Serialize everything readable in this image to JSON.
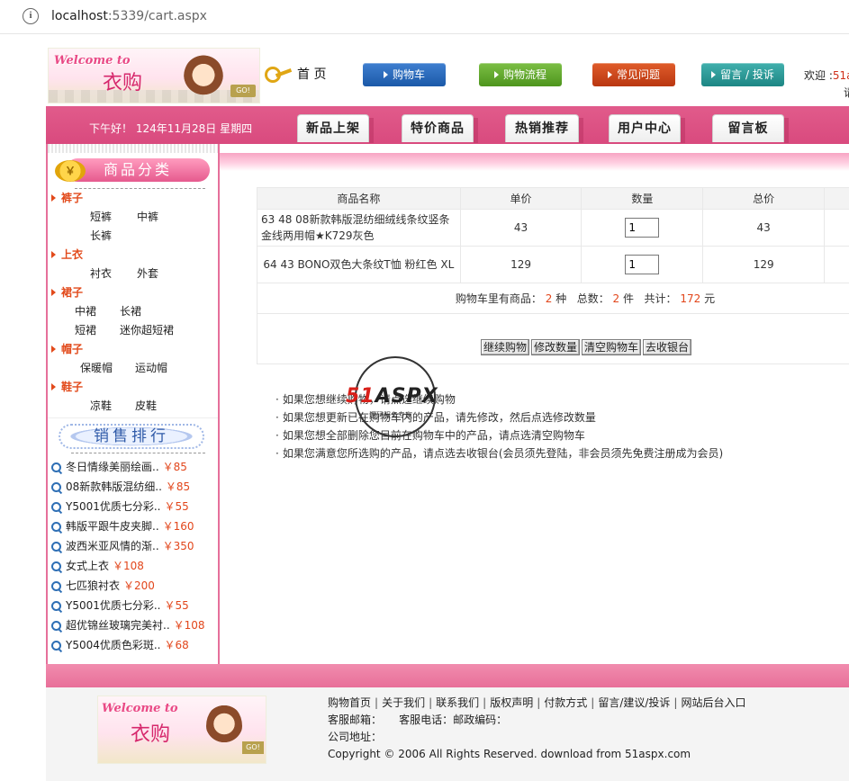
{
  "browser": {
    "host": "localhost",
    "port": ":5339",
    "path": "/cart.aspx"
  },
  "header": {
    "logo_welcome": "Welcome to",
    "logo_name": "衣购",
    "logo_go": "GO!",
    "home_label": "首 页",
    "nav": [
      {
        "label": "购物车",
        "color": "#1b59a8"
      },
      {
        "label": "购物流程",
        "color": "#4e951d"
      },
      {
        "label": "常见问题",
        "color": "#b93711"
      },
      {
        "label": "留言 / 投诉",
        "color": "#1d8684"
      }
    ],
    "welcome_prefix": "欢迎 :",
    "welcome_user": "51a",
    "welcome_line2": "请"
  },
  "menubar": {
    "greeting": "下午好！ 124年11月28日 星期四",
    "tabs": [
      "新品上架",
      "特价商品",
      "热销推荐",
      "用户中心",
      "留言板"
    ]
  },
  "sidebar": {
    "category_title": "商品分类",
    "coin": "￥",
    "categories": [
      {
        "title": "裤子",
        "items": [
          "短裤",
          "中裤",
          "长裤"
        ]
      },
      {
        "title": "上衣",
        "items": [
          "衬衣",
          "外套"
        ]
      },
      {
        "title": "裙子",
        "items": [
          "中裙",
          "长裙",
          "短裙",
          "迷你超短裙"
        ]
      },
      {
        "title": "帽子",
        "items": [
          "保暖帽",
          "运动帽"
        ]
      },
      {
        "title": "鞋子",
        "items": [
          "凉鞋",
          "皮鞋"
        ]
      }
    ],
    "ranking_title": "销售排行",
    "ranking": [
      {
        "name": "冬日情缘美丽绘画..",
        "price": "￥85"
      },
      {
        "name": "08新款韩版混纺细..",
        "price": "￥85"
      },
      {
        "name": "Y5001优质七分彩..",
        "price": "￥55"
      },
      {
        "name": "韩版平跟牛皮夹脚..",
        "price": "￥160"
      },
      {
        "name": "波西米亚风情的渐..",
        "price": "￥350"
      },
      {
        "name": "女式上衣",
        "price": "￥108"
      },
      {
        "name": "七匹狼衬衣",
        "price": "￥200"
      },
      {
        "name": "Y5001优质七分彩..",
        "price": "￥55"
      },
      {
        "name": "超优锦丝玻璃完美衬..",
        "price": "￥108"
      },
      {
        "name": "Y5004优质色彩斑..",
        "price": "￥68"
      }
    ]
  },
  "cart": {
    "headers": [
      "商品名称",
      "单价",
      "数量",
      "总价"
    ],
    "rows": [
      {
        "name": "63 48 08新款韩版混纺细绒线条纹竖条金线两用帽★K729灰色",
        "price": "43",
        "qty": "1",
        "total": "43"
      },
      {
        "name": "64 43 BONO双色大条纹T恤 粉红色 XL",
        "price": "129",
        "qty": "1",
        "total": "129"
      }
    ],
    "summary": {
      "label1": "购物车里有商品：",
      "kinds": "2",
      "unit1": "种",
      "label2": "总数：",
      "count": "2",
      "unit2": "件",
      "label3": "共计：",
      "amount": "172",
      "unit3": "元"
    },
    "buttons": [
      "继续购物",
      "修改数量",
      "清空购物车",
      "去收银台"
    ],
    "notes": [
      "如果您想继续购物，请点选继续购物",
      "如果您想更新已在购物车内的产品，请先修改，然后点选修改数量",
      "如果您想全部删除您目前在购物车中的产品，请点选清空购物车",
      "如果您满意您所选购的产品，请点选去收银台(会员须先登陆，非会员须先免费注册成为会员)"
    ]
  },
  "watermark": {
    "brand_red": "51",
    "brand_black": "ASPX",
    "tagline": "源码服务专家"
  },
  "footer": {
    "links": [
      "购物首页",
      "关于我们",
      "联系我们",
      "版权声明",
      "付款方式",
      "留言/建议/投诉",
      "网站后台入口"
    ],
    "line2": "客服邮箱：     客服电话：邮政编码：",
    "line3": "公司地址：",
    "copyright": "Copyright © 2006 All Rights Reserved. download from 51aspx.com"
  }
}
